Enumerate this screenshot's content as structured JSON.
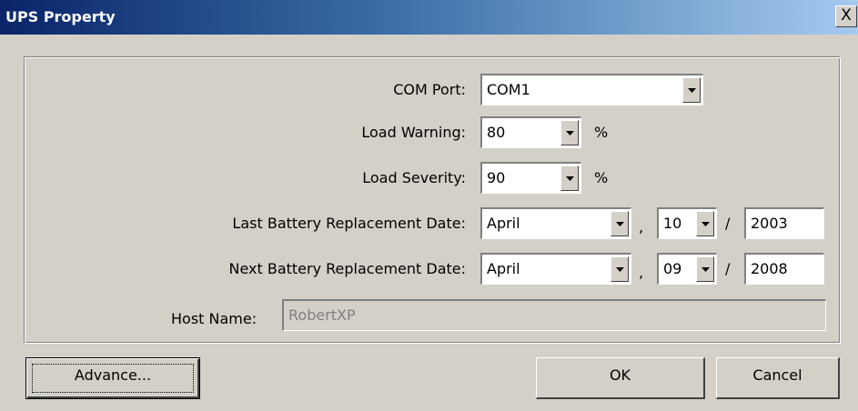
{
  "window": {
    "title": "UPS Property",
    "close_label": "X"
  },
  "form": {
    "com_port": {
      "label": "COM Port:",
      "value": "COM1"
    },
    "load_warning": {
      "label": "Load Warning:",
      "value": "80",
      "unit": "%"
    },
    "load_severity": {
      "label": "Load Severity:",
      "value": "90",
      "unit": "%"
    },
    "last_battery": {
      "label": "Last Battery Replacement Date:",
      "month": "April",
      "day": "10",
      "year": "2003"
    },
    "next_battery": {
      "label": "Next Battery Replacement Date:",
      "month": "April",
      "day": "09",
      "year": "2008"
    },
    "separators": {
      "comma": ",",
      "slash": "/"
    },
    "host_name": {
      "label": "Host Name:",
      "value": "RobertXP"
    }
  },
  "buttons": {
    "advance": "Advance...",
    "ok": "OK",
    "cancel": "Cancel"
  }
}
